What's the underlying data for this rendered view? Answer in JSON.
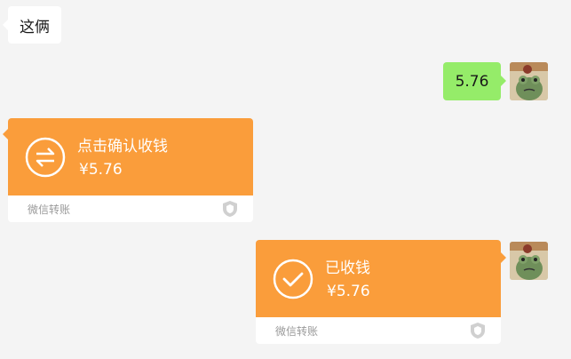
{
  "chat": {
    "incoming_text": "这俩",
    "outgoing_text": "5.76"
  },
  "transfer_pending": {
    "status": "点击确认收钱",
    "amount": "¥5.76",
    "label": "微信转账",
    "icon": "transfer-arrows-icon"
  },
  "transfer_received": {
    "status": "已收钱",
    "amount": "¥5.76",
    "label": "微信转账",
    "icon": "checkmark-icon"
  },
  "colors": {
    "background": "#f4f4f4",
    "outgoing_bubble": "#95ec69",
    "incoming_bubble": "#ffffff",
    "transfer_orange": "#fa9d3b"
  }
}
